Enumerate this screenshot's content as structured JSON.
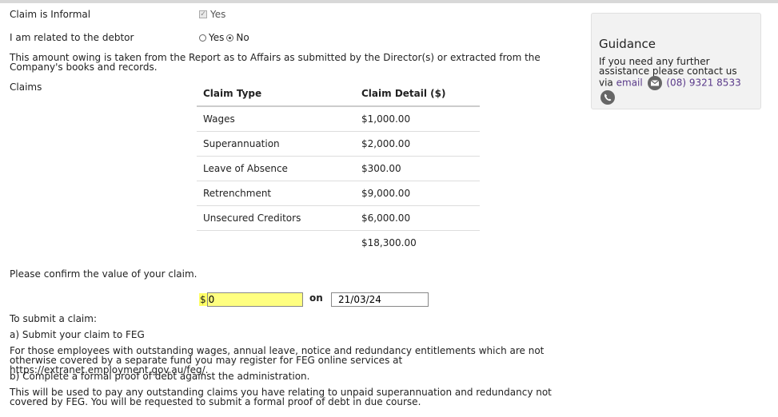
{
  "form": {
    "informal_label": "Claim is Informal",
    "informal_value": "Yes",
    "related_label": "I am related to the debtor",
    "related_yes": "Yes",
    "related_no": "No",
    "amount_note": "This amount owing is taken from the Report as to Affairs as submitted by the Director(s) or extracted from the Company's books and records.",
    "claims_label": "Claims"
  },
  "claims_table": {
    "headers": [
      "Claim Type",
      "Claim Detail ($)"
    ],
    "rows": [
      {
        "type": "Wages",
        "amount": "$1,000.00"
      },
      {
        "type": "Superannuation",
        "amount": "$2,000.00"
      },
      {
        "type": "Leave of Absence",
        "amount": "$300.00"
      },
      {
        "type": "Retrenchment",
        "amount": "$9,000.00"
      },
      {
        "type": "Unsecured Creditors",
        "amount": "$6,000.00"
      }
    ],
    "total": "$18,300.00"
  },
  "confirm": {
    "prompt": "Please confirm the value of your claim.",
    "currency": "$",
    "value": "0",
    "on_label": "on",
    "date": "21/03/24"
  },
  "submit": {
    "heading": "To submit a claim:",
    "step_a": "a) Submit your claim to FEG",
    "step_a_detail": "For those employees with outstanding wages, annual leave, notice and redundancy entitlements which are not otherwise covered by a separate fund you may register for FEG online services at",
    "feg_link": "https://extranet.employment.gov.au/feg/",
    "step_b": "b) Complete a formal proof of debt against the administration.",
    "step_b_detail": "This will be used to pay any outstanding claims you have relating to unpaid superannuation and redundancy not covered by FEG. You will be requested to submit a formal proof of debt in due course."
  },
  "guidance": {
    "title": "Guidance",
    "text": "If you need any further assistance please contact us",
    "via": "via",
    "email_link": "email",
    "phone_link": "(08) 9321 8533",
    "icons": [
      "envelope-icon",
      "phone-icon"
    ]
  }
}
